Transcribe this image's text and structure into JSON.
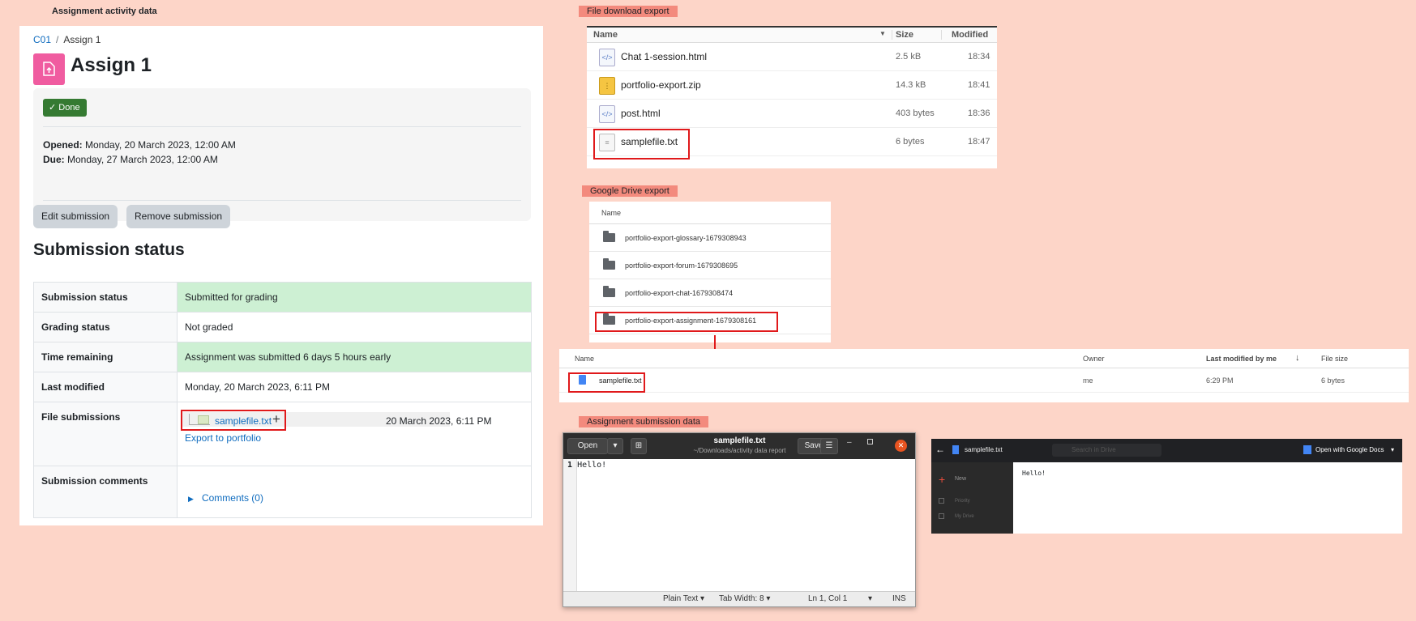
{
  "labels": {
    "assignment_activity": "Assignment activity data",
    "file_download": "File download export",
    "google_drive": "Google Drive export",
    "assignment_submission": "Assignment submission data"
  },
  "moodle": {
    "breadcrumb": [
      "C01",
      "Assign 1"
    ],
    "title": "Assign 1",
    "done_badge": "Done",
    "opened_label": "Opened:",
    "opened_value": "Monday, 20 March 2023, 12:00 AM",
    "due_label": "Due:",
    "due_value": "Monday, 27 March 2023, 12:00 AM",
    "edit_button": "Edit submission",
    "remove_button": "Remove submission",
    "section_heading": "Submission status",
    "rows": [
      {
        "label": "Submission status",
        "value": "Submitted for grading"
      },
      {
        "label": "Grading status",
        "value": "Not graded"
      },
      {
        "label": "Time remaining",
        "value": "Assignment was submitted 6 days 5 hours early"
      },
      {
        "label": "Last modified",
        "value": "Monday, 20 March 2023, 6:11 PM"
      },
      {
        "label": "File submissions",
        "value": ""
      },
      {
        "label": "Submission comments",
        "value": ""
      }
    ],
    "file_name": "samplefile.txt",
    "file_plus": "+",
    "file_date": "20 March 2023, 6:11 PM",
    "export_link": "Export to portfolio",
    "comments_link": "Comments (0)"
  },
  "file_manager": {
    "columns": {
      "name": "Name",
      "size": "Size",
      "modified": "Modified"
    },
    "files": [
      {
        "name": "Chat 1-session.html",
        "size": "2.5 kB",
        "modified": "18:34",
        "icon": "html-file-icon"
      },
      {
        "name": "portfolio-export.zip",
        "size": "14.3 kB",
        "modified": "18:41",
        "icon": "zip-file-icon"
      },
      {
        "name": "post.html",
        "size": "403 bytes",
        "modified": "18:36",
        "icon": "html-file-icon"
      },
      {
        "name": "samplefile.txt",
        "size": "6 bytes",
        "modified": "18:47",
        "icon": "text-file-icon"
      }
    ]
  },
  "gdrive_folders": {
    "column": "Name",
    "folders": [
      "portfolio-export-glossary-1679308943",
      "portfolio-export-forum-1679308695",
      "portfolio-export-chat-1679308474",
      "portfolio-export-assignment-1679308161"
    ]
  },
  "gdrive_files": {
    "columns": {
      "name": "Name",
      "owner": "Owner",
      "modified": "Last modified by me",
      "size": "File size"
    },
    "file": {
      "name": "samplefile.txt",
      "owner": "me",
      "modified": "6:29 PM",
      "size": "6 bytes"
    }
  },
  "editor": {
    "open": "Open",
    "save": "Save",
    "title": "samplefile.txt",
    "path": "~/Downloads/activity data report",
    "line_no": "1",
    "content": "Hello!",
    "status_lang": "Plain Text",
    "status_tab": "Tab Width: 8",
    "status_pos": "Ln 1, Col 1",
    "status_ins": "INS"
  },
  "docs": {
    "file": "samplefile.txt",
    "search": "Search in Drive",
    "open_with": "Open with Google Docs",
    "new": "New",
    "priority": "Priority",
    "my_drive": "My Drive",
    "content": "Hello!"
  }
}
